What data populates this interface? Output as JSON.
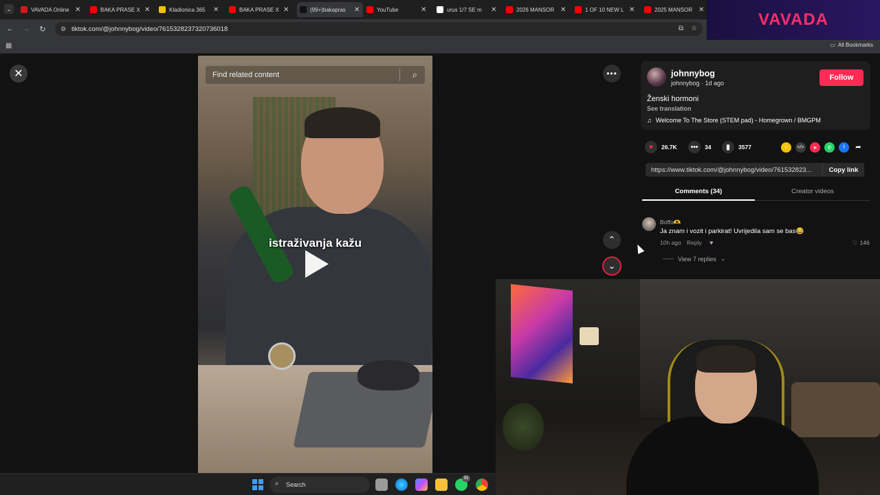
{
  "browser": {
    "tabs": [
      {
        "title": "VAVADA Online",
        "color": "#d01a1a"
      },
      {
        "title": "BAKA PRASE X",
        "color": "#ff0000"
      },
      {
        "title": "Kladionica 365",
        "color": "#f2c200"
      },
      {
        "title": "BAKA PRASE X",
        "color": "#ff0000"
      },
      {
        "title": "(99+)bakapras",
        "color": "#111111"
      },
      {
        "title": "YouTube",
        "color": "#ff0000"
      },
      {
        "title": "urus 1/7 SE m",
        "color": "#ffffff"
      },
      {
        "title": "2026 MANSOR",
        "color": "#ff0000"
      },
      {
        "title": "1 OF 10 NEW L",
        "color": "#ff0000"
      },
      {
        "title": "2025 MANSOR",
        "color": "#ff0000"
      }
    ],
    "url": "tiktok.com/@johnnybog/video/7615328237320736018",
    "all_bookmarks": "All Bookmarks"
  },
  "banner": {
    "text": "VAVADA"
  },
  "video": {
    "search_placeholder": "Find related content",
    "caption": "istraživanja kažu"
  },
  "post": {
    "username": "johnnybog",
    "subline": "johnnybog · 1d ago",
    "follow_label": "Follow",
    "description": "Ženski hormoni",
    "see_translation": "See translation",
    "music": "Welcome To The Store (STEM pad) - Homegrown / BMGPM",
    "likes": "26.7K",
    "comments": "34",
    "saves": "3577",
    "link": "https://www.tiktok.com/@johnnybog/video/761532823...",
    "copy_link": "Copy link"
  },
  "tabs": {
    "comments": "Comments (34)",
    "creator_videos": "Creator videos"
  },
  "comment": {
    "user": "Boffo🫶",
    "text": "Ja znam i vozit i parkirat! Uvrijedila sam se bas😂",
    "time": "10h ago",
    "reply": "Reply",
    "likes": "146",
    "view_replies": "View 7 replies"
  },
  "taskbar": {
    "search": "Search",
    "badge": "93"
  },
  "colors": {
    "accent": "#fe2c55",
    "background": "#121212"
  }
}
